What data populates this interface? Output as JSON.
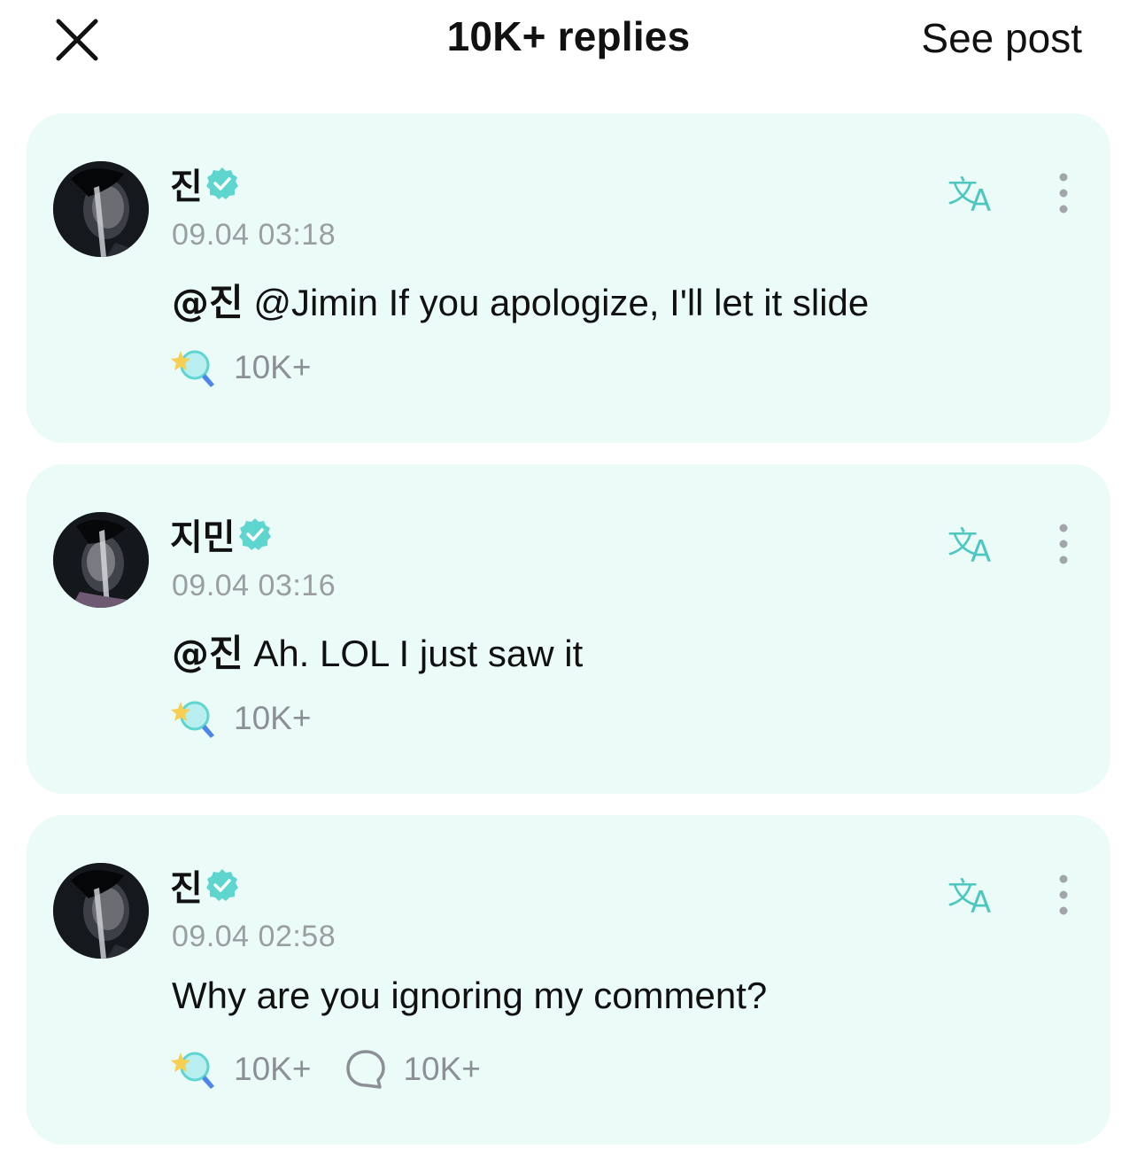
{
  "header": {
    "title": "10K+ replies",
    "see_post_label": "See post"
  },
  "colors": {
    "card_bg": "#eafbf8",
    "accent_teal": "#4fd1c5",
    "timestamp": "#9a9ea3",
    "count": "#8c9096"
  },
  "comments": [
    {
      "author": "진",
      "verified": true,
      "timestamp": "09.04 03:18",
      "mention": "@진",
      "text": "@Jimin If you apologize, I'll let it slide",
      "reactions": "10K+",
      "replies": null,
      "avatar_icon": "avatar"
    },
    {
      "author": "지민",
      "verified": true,
      "timestamp": "09.04 03:16",
      "mention": "@진",
      "text": "Ah. LOL I just saw it",
      "reactions": "10K+",
      "replies": null,
      "avatar_icon": "avatar"
    },
    {
      "author": "진",
      "verified": true,
      "timestamp": "09.04 02:58",
      "mention": "",
      "text": "Why are you ignoring my comment?",
      "reactions": "10K+",
      "replies": "10K+",
      "avatar_icon": "avatar"
    }
  ],
  "icons": {
    "close": "close-icon",
    "verified": "verified-badge-icon",
    "translate": "translate-icon",
    "more": "more-vertical-icon",
    "reaction": "star-lightstick-reaction-icon",
    "reply": "speech-bubble-icon"
  }
}
